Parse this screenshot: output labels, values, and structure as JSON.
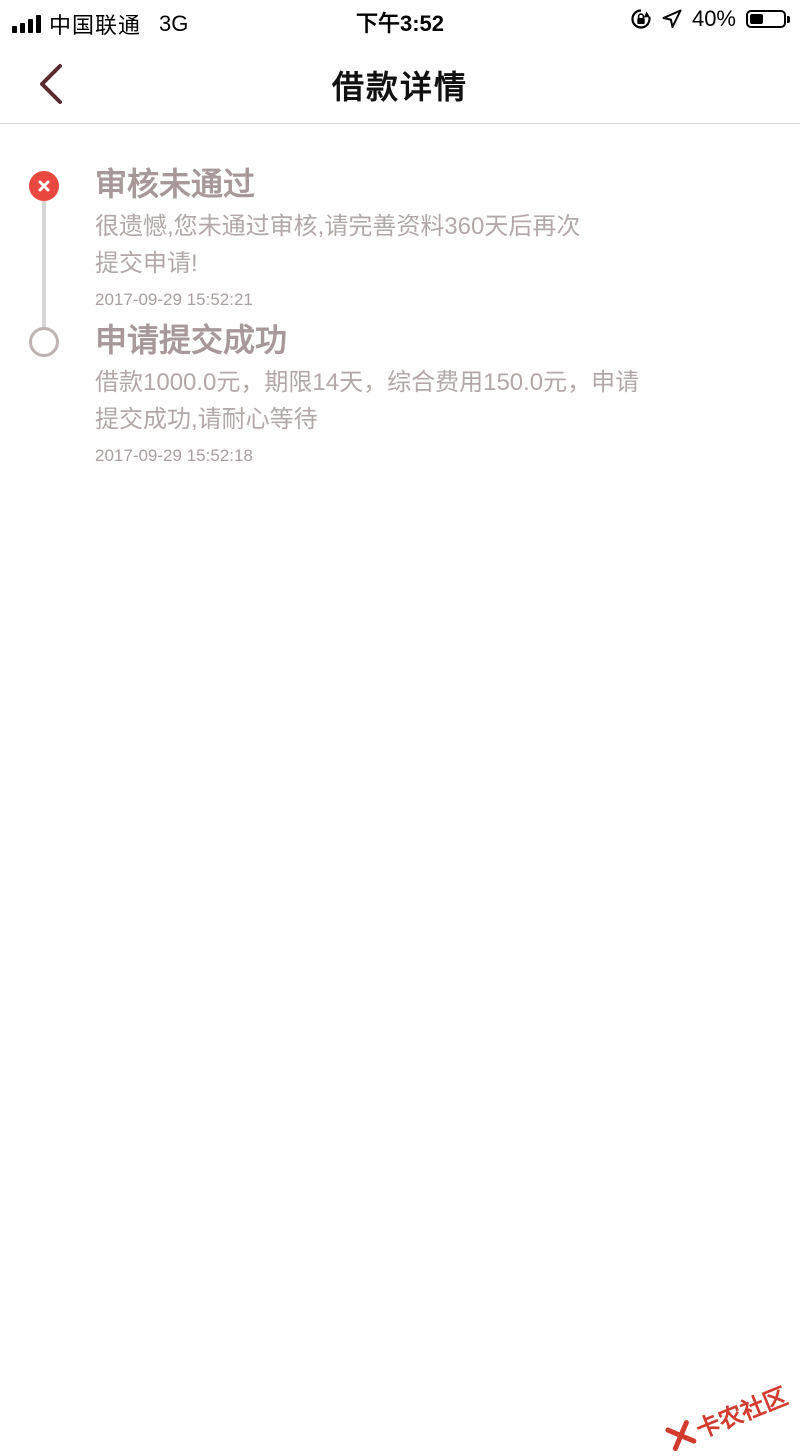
{
  "status_bar": {
    "carrier": "中国联通",
    "network": "3G",
    "time": "下午3:52",
    "battery_percent": "40%",
    "battery_level": 0.4
  },
  "nav": {
    "title": "借款详情",
    "back_icon": "chevron-left-icon",
    "accent_color": "#5a2a33"
  },
  "timeline": [
    {
      "status": "failed",
      "icon": "close-icon",
      "color": "#e8483e",
      "title": "审核未通过",
      "desc_line1": "很遗憾,您未通过审核,请完善资料360天后再次",
      "desc_line2": "提交申请!",
      "time": "2017-09-29 15:52:21"
    },
    {
      "status": "pending",
      "icon": "circle-outline-icon",
      "color": "#bdb3b3",
      "title": "申请提交成功",
      "desc_line1": "借款1000.0元，期限14天，综合费用150.0元，申请",
      "desc_line2": "提交成功,请耐心等待",
      "time": "2017-09-29 15:52:18"
    }
  ],
  "watermark": {
    "text": "卡农社区"
  }
}
